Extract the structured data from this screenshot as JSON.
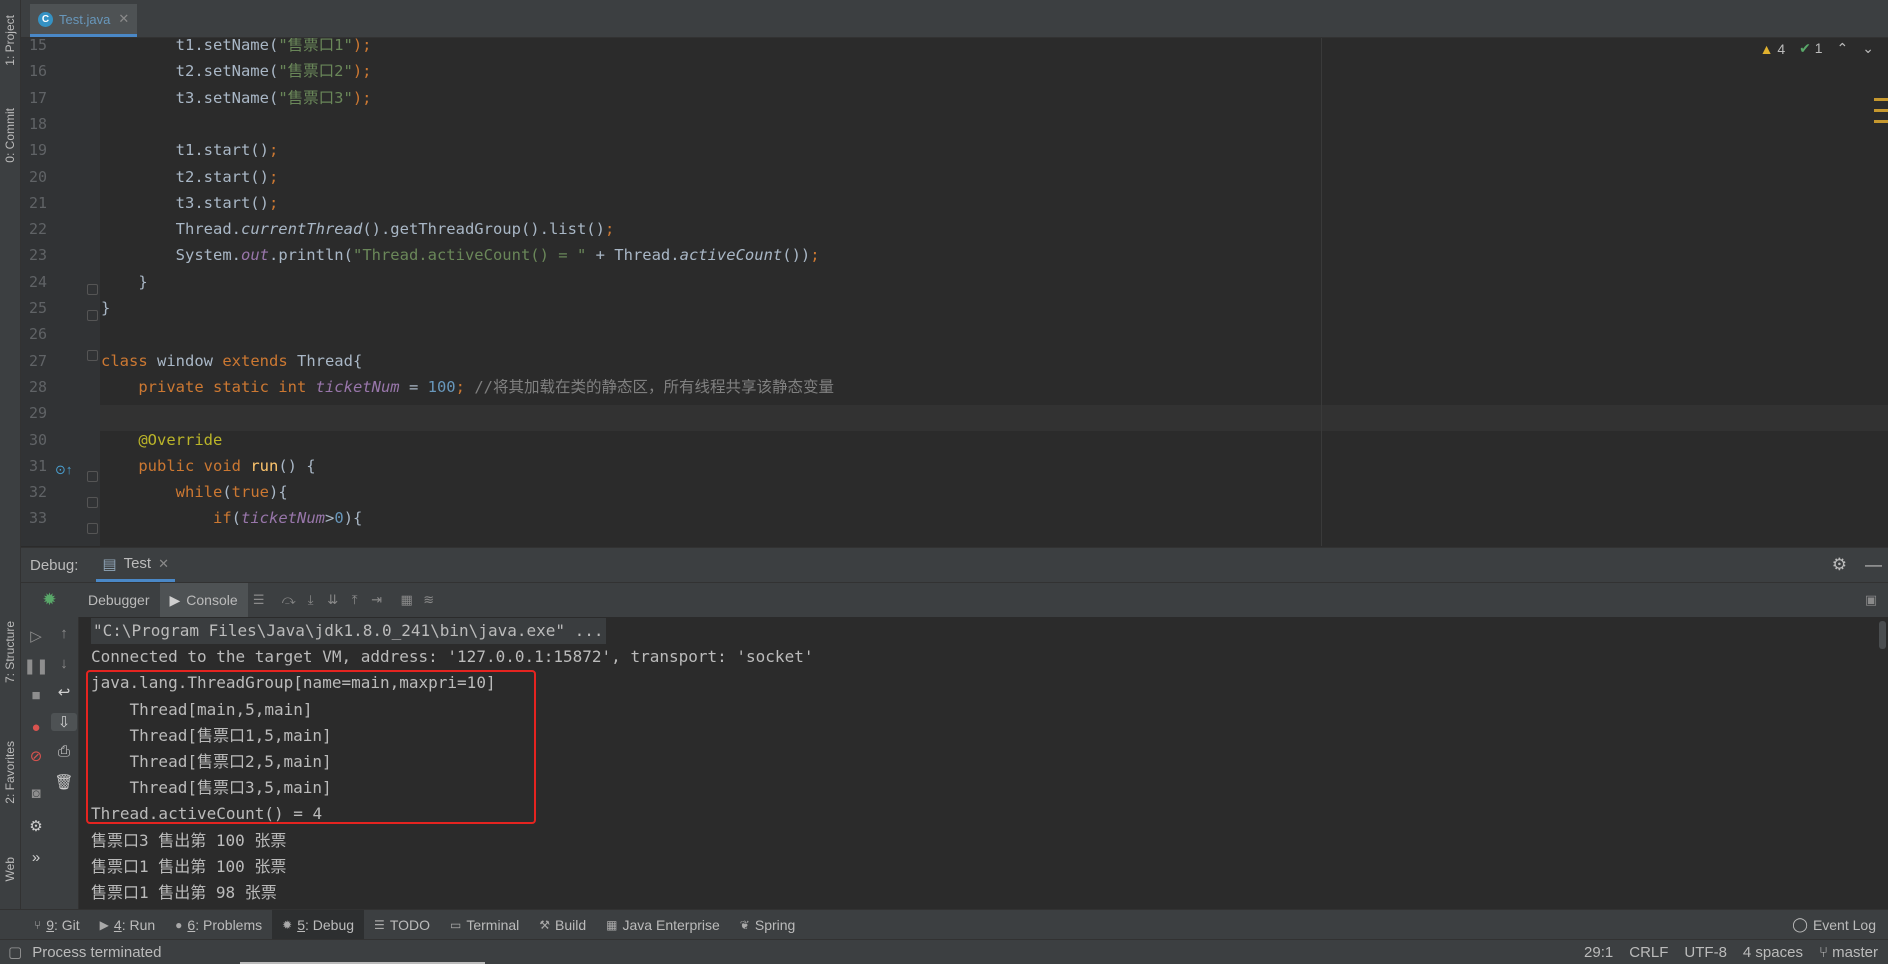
{
  "left_strip": {
    "tabs": [
      {
        "label": "1: Project",
        "icon": "folder-icon"
      },
      {
        "label": "0: Commit",
        "icon": "commit-icon"
      },
      {
        "label": "7: Structure",
        "icon": "structure-icon"
      },
      {
        "label": "2: Favorites",
        "icon": "star-icon"
      },
      {
        "label": "Web",
        "icon": "web-icon"
      }
    ]
  },
  "editor_tab": {
    "label": "Test.java",
    "icon": "java-class-icon",
    "icon_glyph": "C"
  },
  "inspections": {
    "warnings": "4",
    "weak_warnings": "1"
  },
  "editor": {
    "line_numbers": [
      "15",
      "16",
      "17",
      "18",
      "19",
      "20",
      "21",
      "22",
      "23",
      "24",
      "25",
      "26",
      "27",
      "28",
      "29",
      "30",
      "31",
      "32",
      "33"
    ],
    "lines": [
      [
        {
          "t": "        t1.setName(",
          "c": ""
        },
        {
          "t": "\"售票口1\"",
          "c": "str"
        },
        {
          "t": ");",
          "c": "kw"
        }
      ],
      [
        {
          "t": "        t2.setName(",
          "c": ""
        },
        {
          "t": "\"售票口2\"",
          "c": "str"
        },
        {
          "t": ");",
          "c": "kw"
        }
      ],
      [
        {
          "t": "        t3.setName(",
          "c": ""
        },
        {
          "t": "\"售票口3\"",
          "c": "str"
        },
        {
          "t": ");",
          "c": "kw"
        }
      ],
      [],
      [
        {
          "t": "        t1.start()",
          "c": ""
        },
        {
          "t": ";",
          "c": "kw"
        }
      ],
      [
        {
          "t": "        t2.start()",
          "c": ""
        },
        {
          "t": ";",
          "c": "kw"
        }
      ],
      [
        {
          "t": "        t3.start()",
          "c": ""
        },
        {
          "t": ";",
          "c": "kw"
        }
      ],
      [
        {
          "t": "        Thread.",
          "c": ""
        },
        {
          "t": "currentThread",
          "c": "it"
        },
        {
          "t": "().getThreadGroup().list()",
          "c": ""
        },
        {
          "t": ";",
          "c": "kw"
        }
      ],
      [
        {
          "t": "        System.",
          "c": ""
        },
        {
          "t": "out",
          "c": "field"
        },
        {
          "t": ".println(",
          "c": ""
        },
        {
          "t": "\"Thread.activeCount() = \"",
          "c": "str"
        },
        {
          "t": " + Thread.",
          "c": ""
        },
        {
          "t": "activeCount",
          "c": "it"
        },
        {
          "t": "())",
          "c": ""
        },
        {
          "t": ";",
          "c": "kw"
        }
      ],
      [
        {
          "t": "    }",
          "c": ""
        }
      ],
      [
        {
          "t": "}",
          "c": ""
        }
      ],
      [],
      [
        {
          "t": "class ",
          "c": "kw"
        },
        {
          "t": "window ",
          "c": ""
        },
        {
          "t": "extends ",
          "c": "kw"
        },
        {
          "t": "Thread{",
          "c": ""
        }
      ],
      [
        {
          "t": "    private static int ",
          "c": "kw"
        },
        {
          "t": "ticketNum",
          "c": "field"
        },
        {
          "t": " = ",
          "c": ""
        },
        {
          "t": "100",
          "c": "num"
        },
        {
          "t": "; ",
          "c": "kw"
        },
        {
          "t": "//将其加载在类的静态区，所有线程共享该静态变量",
          "c": "cmt"
        }
      ],
      [],
      [
        {
          "t": "    @Override",
          "c": "ann"
        }
      ],
      [
        {
          "t": "    public void ",
          "c": "kw"
        },
        {
          "t": "run",
          "c": "fn"
        },
        {
          "t": "() {",
          "c": ""
        }
      ],
      [
        {
          "t": "        while",
          "c": "kw"
        },
        {
          "t": "(",
          "c": ""
        },
        {
          "t": "true",
          "c": "kw"
        },
        {
          "t": "){",
          "c": ""
        }
      ],
      [
        {
          "t": "            if",
          "c": "kw"
        },
        {
          "t": "(",
          "c": ""
        },
        {
          "t": "ticketNum",
          "c": "field"
        },
        {
          "t": ">",
          "c": ""
        },
        {
          "t": "0",
          "c": "num"
        },
        {
          "t": "){",
          "c": ""
        }
      ]
    ]
  },
  "debug": {
    "title": "Debug:",
    "session_tab": "Test",
    "tabs": {
      "debugger": "Debugger",
      "console": "Console"
    },
    "console_lines": [
      "\"C:\\Program Files\\Java\\jdk1.8.0_241\\bin\\java.exe\" ...",
      "Connected to the target VM, address: '127.0.0.1:15872', transport: 'socket'",
      "java.lang.ThreadGroup[name=main,maxpri=10]",
      "    Thread[main,5,main]",
      "    Thread[售票口1,5,main]",
      "    Thread[售票口2,5,main]",
      "    Thread[售票口3,5,main]",
      "Thread.activeCount() = 4",
      "售票口3 售出第 100 张票",
      "售票口1 售出第 100 张票",
      "售票口1 售出第 98 张票"
    ]
  },
  "tool_windows": [
    {
      "key": "9",
      "label": ": Git",
      "icon": "git-icon",
      "glyph": "⑂"
    },
    {
      "key": "4",
      "label": ": Run",
      "icon": "run-icon",
      "glyph": "▶"
    },
    {
      "key": "6",
      "label": ": Problems",
      "icon": "problems-icon",
      "glyph": "●"
    },
    {
      "key": "5",
      "label": ": Debug",
      "icon": "bug-icon",
      "glyph": "✹",
      "active": true
    },
    {
      "key": "",
      "label": "TODO",
      "icon": "list-icon",
      "glyph": "☰"
    },
    {
      "key": "",
      "label": "Terminal",
      "icon": "terminal-icon",
      "glyph": "▭"
    },
    {
      "key": "",
      "label": "Build",
      "icon": "hammer-icon",
      "glyph": "⚒"
    },
    {
      "key": "",
      "label": "Java Enterprise",
      "icon": "enterprise-icon",
      "glyph": "▦"
    },
    {
      "key": "",
      "label": "Spring",
      "icon": "spring-icon",
      "glyph": "❦"
    }
  ],
  "event_log": "Event Log",
  "status": {
    "message": "Process terminated",
    "position": "29:1",
    "line_sep": "CRLF",
    "encoding": "UTF-8",
    "indent": "4 spaces",
    "branch": "master"
  },
  "colors": {
    "accent": "#4a88c7",
    "highlight_box": "#e52420"
  }
}
